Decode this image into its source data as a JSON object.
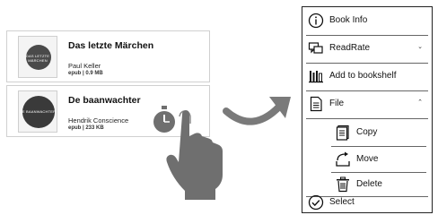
{
  "books": [
    {
      "title": "Das letzte Märchen",
      "author": "Paul Keller",
      "meta": "epub | 0.9 MB",
      "cover_text": "DAS LETZTE MÄRCHEN"
    },
    {
      "title": "De baanwachter",
      "author": "Hendrik Conscience",
      "meta": "epub | 233 KB",
      "cover_text": "DE BAANWACHTER"
    }
  ],
  "menu": {
    "book_info": "Book Info",
    "readrate": "ReadRate",
    "add_to_bookshelf": "Add to bookshelf",
    "file": "File",
    "copy": "Copy",
    "move": "Move",
    "delete": "Delete",
    "select": "Select",
    "readrate_chevron": "⌄",
    "file_chevron": "⌃"
  },
  "colors": {
    "gesture_gray": "#6f6f6f",
    "arrow_gray": "#7a7a7a",
    "menu_border": "#222222"
  },
  "icons": [
    "info-icon",
    "readrate-icon",
    "bookshelf-icon",
    "file-icon",
    "copy-icon",
    "move-icon",
    "delete-icon",
    "select-icon",
    "hand-icon",
    "clock-icon",
    "curved-arrow-icon"
  ]
}
